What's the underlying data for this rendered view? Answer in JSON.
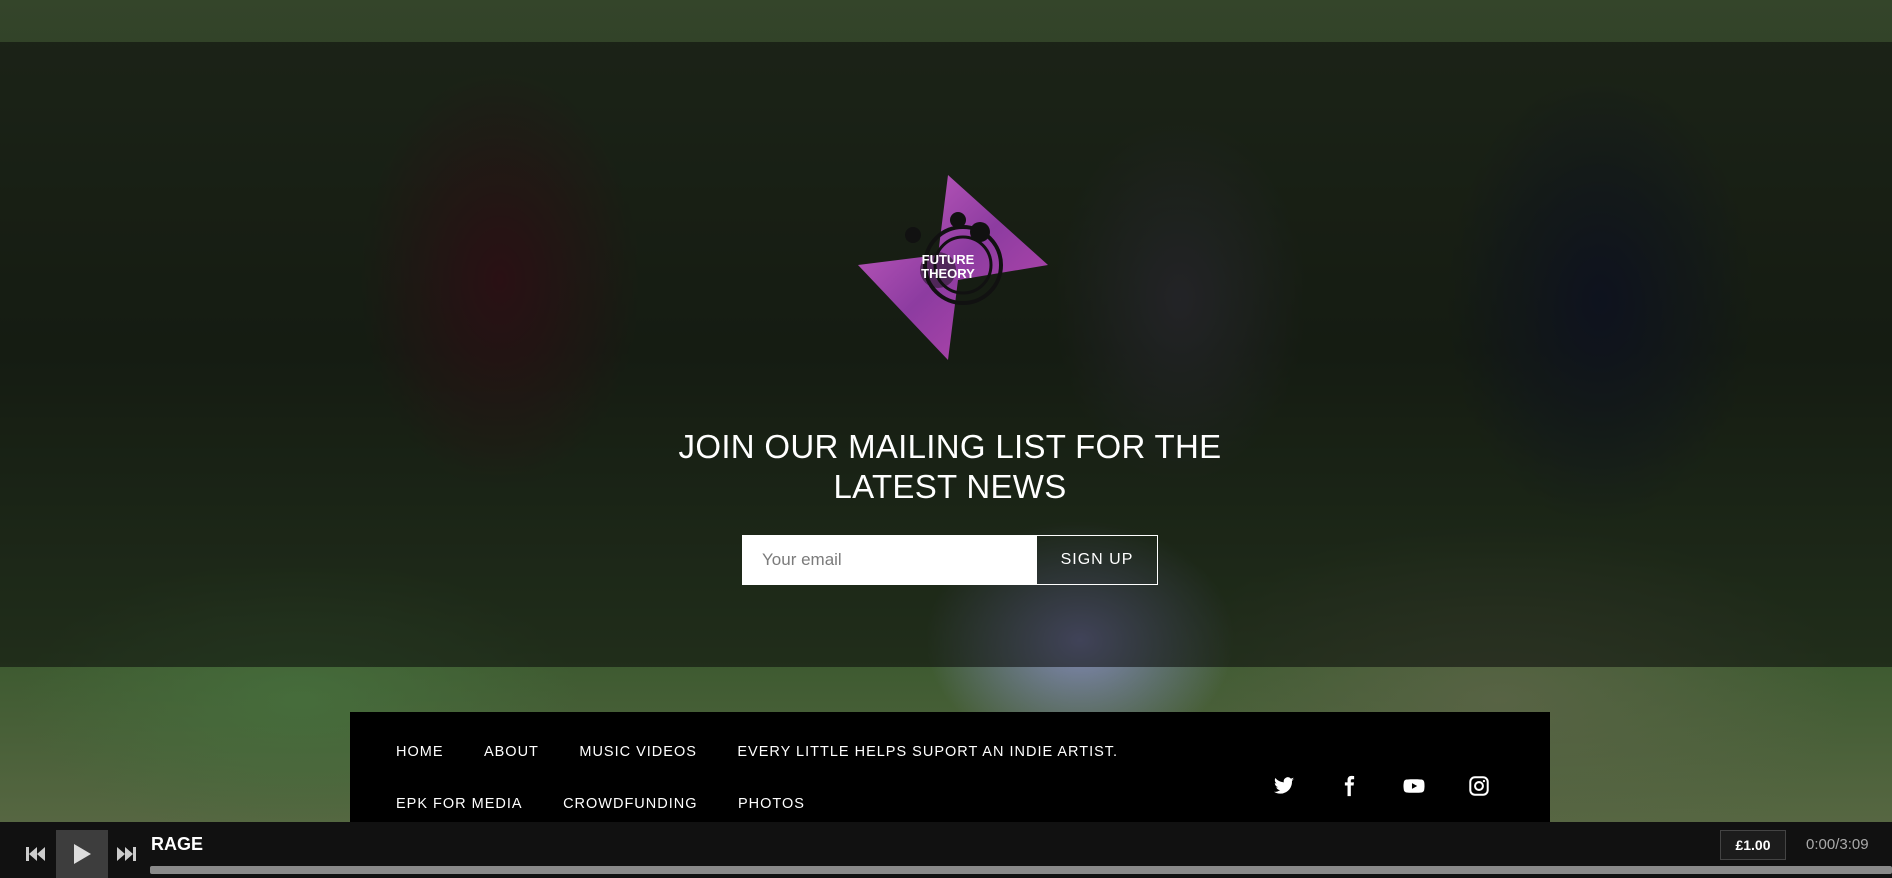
{
  "signup": {
    "heading": "JOIN OUR MAILING LIST FOR THE LATEST NEWS",
    "email_placeholder": "Your email",
    "button_label": "SIGN UP"
  },
  "logo": {
    "text_line1": "FUTURE",
    "text_line2": "THEORY"
  },
  "nav": {
    "items": [
      {
        "label": "HOME"
      },
      {
        "label": "ABOUT"
      },
      {
        "label": "MUSIC VIDEOS"
      },
      {
        "label": "EVERY LITTLE HELPS SUPORT AN INDIE ARTIST."
      },
      {
        "label": "EPK FOR MEDIA"
      },
      {
        "label": "CROWDFUNDING"
      },
      {
        "label": "PHOTOS"
      }
    ]
  },
  "social": [
    "twitter-icon",
    "facebook-icon",
    "youtube-icon",
    "instagram-icon"
  ],
  "player": {
    "track_title": "RAGE",
    "price": "£1.00",
    "time": "0:00/3:09",
    "progress": 0
  },
  "colors": {
    "overlay": "#0a0a0a",
    "footer": "#000000",
    "accent_logo": "#c040c0"
  }
}
